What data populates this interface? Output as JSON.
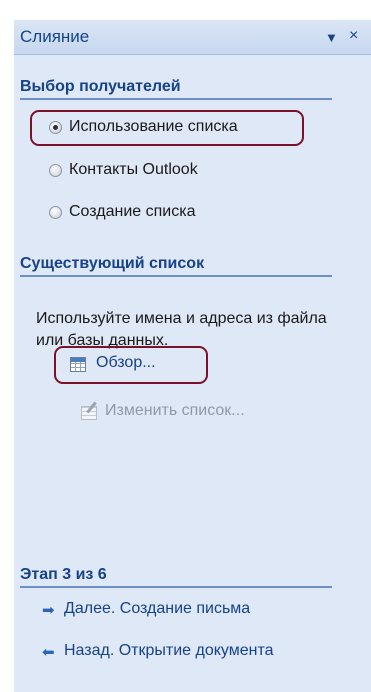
{
  "pane": {
    "title": "Слияние",
    "menu_glyph": "▼",
    "close_glyph": "×"
  },
  "recipients": {
    "heading": "Выбор получателей",
    "options": [
      {
        "label": "Использование списка",
        "checked": true
      },
      {
        "label": "Контакты Outlook",
        "checked": false
      },
      {
        "label": "Создание списка",
        "checked": false
      }
    ]
  },
  "existing_list": {
    "heading": "Существующий список",
    "description": "Используйте имена и адреса из файла или базы данных.",
    "browse_label": "Обзор...",
    "edit_label": "Изменить список..."
  },
  "step": {
    "heading": "Этап 3 из 6",
    "next_label": "Далее. Создание письма",
    "back_label": "Назад. Открытие документа"
  },
  "colors": {
    "pane_background": "#dfe8f6",
    "heading_blue": "#15428b",
    "highlight_border": "#7a1229"
  }
}
